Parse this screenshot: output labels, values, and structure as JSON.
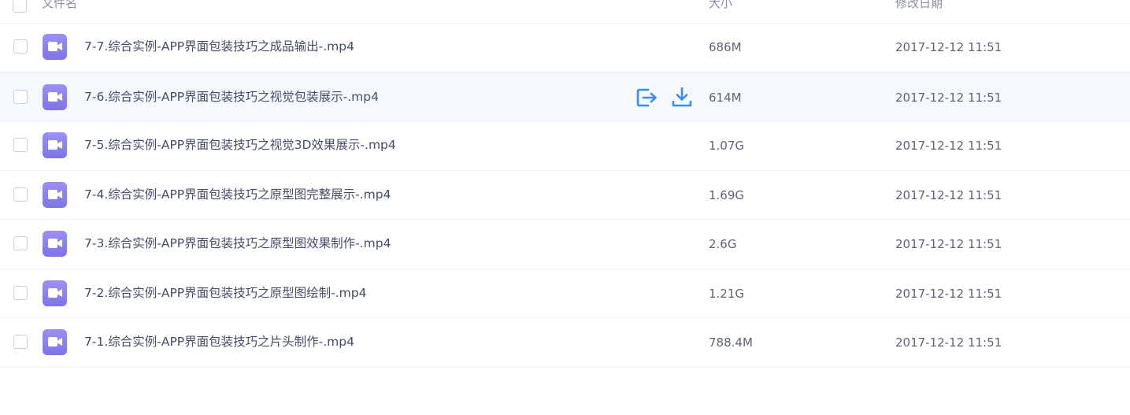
{
  "header": {
    "col_name": "文件名",
    "col_size": "大小",
    "col_date": "修改日期"
  },
  "colors": {
    "video_icon": "#8e84f0",
    "accent_blue": "#3b8cf5",
    "hover_row": "#f5f9fe"
  },
  "icons": {
    "file": "video-file-icon",
    "share": "share-icon",
    "download": "download-icon"
  },
  "files": [
    {
      "name": "7-7.综合实例-APP界面包装技巧之成品输出-.mp4",
      "size": "686M",
      "date": "2017-12-12 11:51"
    },
    {
      "name": "7-6.综合实例-APP界面包装技巧之视觉包装展示-.mp4",
      "size": "614M",
      "date": "2017-12-12 11:51"
    },
    {
      "name": "7-5.综合实例-APP界面包装技巧之视觉3D效果展示-.mp4",
      "size": "1.07G",
      "date": "2017-12-12 11:51"
    },
    {
      "name": "7-4.综合实例-APP界面包装技巧之原型图完整展示-.mp4",
      "size": "1.69G",
      "date": "2017-12-12 11:51"
    },
    {
      "name": "7-3.综合实例-APP界面包装技巧之原型图效果制作-.mp4",
      "size": "2.6G",
      "date": "2017-12-12 11:51"
    },
    {
      "name": "7-2.综合实例-APP界面包装技巧之原型图绘制-.mp4",
      "size": "1.21G",
      "date": "2017-12-12 11:51"
    },
    {
      "name": "7-1.综合实例-APP界面包装技巧之片头制作-.mp4",
      "size": "788.4M",
      "date": "2017-12-12 11:51"
    }
  ]
}
